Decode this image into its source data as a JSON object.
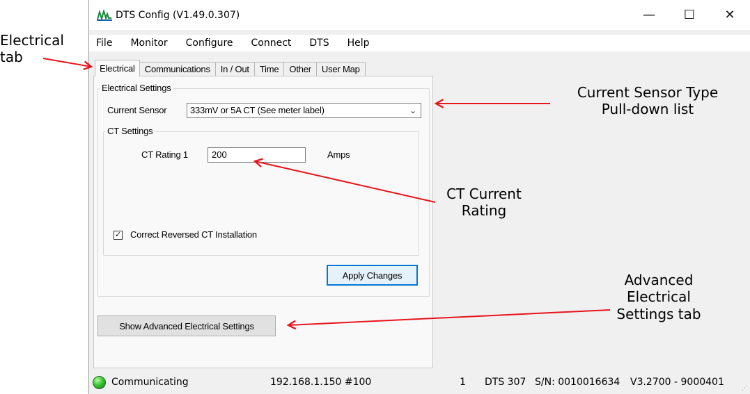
{
  "annotations": {
    "electrical_tab": [
      "Electrical",
      "tab"
    ],
    "current_sensor": [
      "Current Sensor Type",
      "Pull-down list"
    ],
    "ct_rating": [
      "CT Current",
      "Rating"
    ],
    "advanced": [
      "Advanced",
      "Electrical",
      "Settings tab"
    ]
  },
  "colors": {
    "arrow": "#e8141c",
    "focus_border": "#0078d7",
    "status_led": "#3cc33a"
  },
  "window": {
    "title": "DTS Config (V1.49.0.307)",
    "app_icon": "dts-logo-icon",
    "controls": {
      "minimize": "—",
      "maximize": "☐",
      "close": "✕"
    }
  },
  "menu": [
    "File",
    "Monitor",
    "Configure",
    "Connect",
    "DTS",
    "Help"
  ],
  "tabs": [
    "Electrical",
    "Communications",
    "In / Out",
    "Time",
    "Other",
    "User Map"
  ],
  "active_tab": "Electrical",
  "electrical": {
    "group_title": "Electrical Settings",
    "current_sensor_label": "Current Sensor",
    "current_sensor_value": "333mV or 5A CT (See meter label)",
    "ct_group_title": "CT Settings",
    "ct_rating_label": "CT Rating 1",
    "ct_rating_value": "200",
    "ct_rating_unit": "Amps",
    "reversed_ct_label": "Correct Reversed CT Installation",
    "reversed_ct_checked": true,
    "apply_button": "Apply Changes"
  },
  "advanced_button": "Show Advanced Electrical Settings",
  "status": {
    "state": "Communicating",
    "address": "192.168.1.150 #100",
    "count": "1",
    "device": "DTS 307",
    "serial": "S/N: 0010016634",
    "version": "V3.2700 - 9000401"
  }
}
